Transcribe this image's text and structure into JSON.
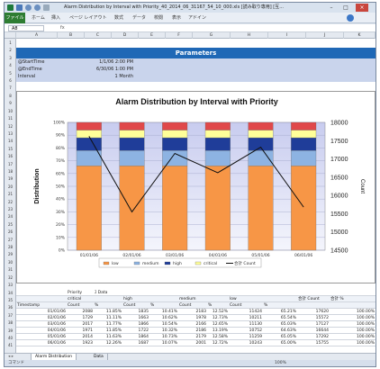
{
  "window": {
    "title": "Alarm Distribution by Interval with Priority_40_2014_06_31167_54_10_000.xls [読み取り専用] [互...",
    "controls": [
      "–",
      "□",
      "×"
    ]
  },
  "ribbon": {
    "file_tab": "ファイル",
    "tabs": [
      "ホーム",
      "挿入",
      "ページ レイアウト",
      "数式",
      "データ",
      "校閲",
      "表示",
      "アドイン"
    ]
  },
  "formula_bar": {
    "name_box": "A8",
    "fx": "fx"
  },
  "columns": [
    "A",
    "B",
    "C",
    "D",
    "E",
    "F",
    "G",
    "H",
    "I",
    "J",
    "K"
  ],
  "rows": [
    "1",
    "2",
    "3",
    "4",
    "5",
    "6",
    "7",
    "8",
    "9",
    "10",
    "11",
    "12",
    "13",
    "14",
    "15",
    "16",
    "17",
    "18",
    "19",
    "20",
    "21",
    "22",
    "23",
    "24",
    "25",
    "26",
    "27",
    "28",
    "29",
    "30",
    "31",
    "32",
    "33",
    "34",
    "35",
    "36",
    "37",
    "38",
    "39",
    "40",
    "41"
  ],
  "params": {
    "header": "Parameters",
    "labels": [
      "@StartTime",
      "@EndTime",
      "Interval"
    ],
    "values": [
      "1/1/06 2:00 PM",
      "6/30/06 1:00 PM",
      "1 Month"
    ]
  },
  "chart_data": {
    "type": "bar",
    "title": "Alarm Distribution  by Interval with Priority",
    "ylabel": "Distribution",
    "ylabel_right": "Count",
    "categories": [
      "01/01/06",
      "02/01/06",
      "03/01/06",
      "04/01/06",
      "05/01/06",
      "06/01/06"
    ],
    "ylim": [
      0,
      100
    ],
    "yticks": [
      "0%",
      "10%",
      "20%",
      "30%",
      "40%",
      "50%",
      "60%",
      "70%",
      "80%",
      "90%",
      "100%"
    ],
    "y2lim": [
      14500,
      18000
    ],
    "y2ticks": [
      "14500",
      "15000",
      "15500",
      "16000",
      "16500",
      "17000",
      "17500",
      "18000"
    ],
    "series": [
      {
        "name": "low",
        "color": "#f79646",
        "values": [
          66,
          66,
          66,
          66,
          66,
          66
        ]
      },
      {
        "name": "medium",
        "color": "#8db3e2",
        "values": [
          12,
          12,
          12,
          12,
          12,
          12
        ]
      },
      {
        "name": "high",
        "color": "#1f3d99",
        "values": [
          10,
          10,
          10,
          10,
          10,
          10
        ]
      },
      {
        "name": "critical",
        "color": "#ffff99",
        "values": [
          6,
          6,
          6,
          6,
          6,
          6
        ]
      },
      {
        "name": "crit2",
        "color": "#e0484a",
        "values": [
          6,
          6,
          6,
          6,
          6,
          6
        ]
      }
    ],
    "line": {
      "name": "合計 Count",
      "values": [
        17620,
        15550,
        17150,
        16620,
        17320,
        15680
      ]
    },
    "legend": [
      "low",
      "medium",
      "high",
      "critical",
      "合計 Count"
    ],
    "legend_position": "bottom",
    "grid": true
  },
  "table": {
    "head1": [
      "",
      "Priority",
      "ｽ Data"
    ],
    "head2": [
      "",
      "critical",
      "",
      "high",
      "",
      "medium",
      "",
      "low",
      "",
      "合計 Count",
      "合計 %"
    ],
    "head3": [
      "Timestamp",
      "Count",
      "%",
      "Count",
      "%",
      "Count",
      "%",
      "Count",
      "%",
      "",
      ""
    ],
    "rows": [
      [
        "01/01/06",
        "2088",
        "11.85%",
        "1835",
        "10.41%",
        "2183",
        "12.52%",
        "11424",
        "65.21%",
        "17620",
        "100.00%"
      ],
      [
        "02/01/06",
        "1729",
        "11.11%",
        "1663",
        "10.62%",
        "1978",
        "12.73%",
        "10211",
        "65.54%",
        "15572",
        "100.00%"
      ],
      [
        "03/01/06",
        "2017",
        "11.77%",
        "1866",
        "10.54%",
        "2166",
        "12.65%",
        "11130",
        "65.03%",
        "17127",
        "100.00%"
      ],
      [
        "04/01/06",
        "1971",
        "11.85%",
        "1722",
        "10.32%",
        "2186",
        "13.19%",
        "10752",
        "64.63%",
        "16644",
        "100.00%"
      ],
      [
        "05/01/06",
        "2014",
        "11.63%",
        "1864",
        "10.73%",
        "2179",
        "12.58%",
        "11259",
        "65.05%",
        "17292",
        "100.00%"
      ],
      [
        "06/01/06",
        "1923",
        "12.26%",
        "1687",
        "10.07%",
        "2001",
        "12.72%",
        "10243",
        "65.00%",
        "15755",
        "100.00%"
      ]
    ]
  },
  "sheet_tabs": [
    "Alarm Distribution",
    "Data"
  ],
  "status": {
    "ready": "コマンド",
    "zoom": "100%"
  }
}
